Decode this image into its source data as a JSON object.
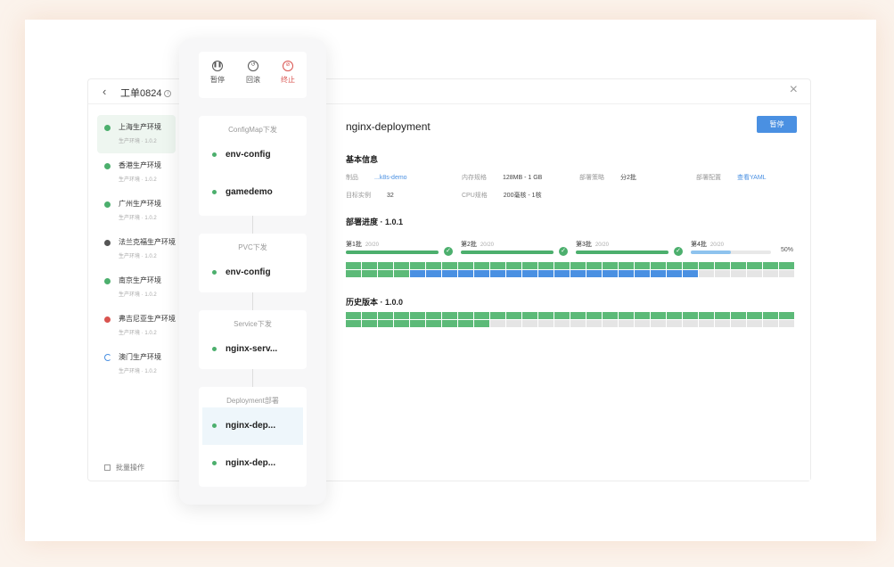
{
  "window": {
    "back_icon": "chevron-left-icon",
    "title": "工单0824",
    "info_icon": "i",
    "close_icon": "×"
  },
  "environments": [
    {
      "name": "上海生产环境",
      "sub": "生产环境 · 1.0.2",
      "status": "success",
      "color": "#4caf6d",
      "active": true
    },
    {
      "name": "香港生产环境",
      "sub": "生产环境 · 1.0.2",
      "status": "success",
      "color": "#4caf6d"
    },
    {
      "name": "广州生产环境",
      "sub": "生产环境 · 1.0.2",
      "status": "success",
      "color": "#4caf6d"
    },
    {
      "name": "法兰克福生产环境",
      "sub": "生产环境 · 1.0.2",
      "status": "paused",
      "color": "#555555"
    },
    {
      "name": "南京生产环境",
      "sub": "生产环境 · 1.0.2",
      "status": "success",
      "color": "#4caf6d"
    },
    {
      "name": "弗吉尼亚生产环境",
      "sub": "生产环境 · 1.0.2",
      "status": "error",
      "color": "#d9534f"
    },
    {
      "name": "澳门生产环境",
      "sub": "生产环境 · 1.0.2",
      "status": "loading",
      "color": "#4a90e2"
    }
  ],
  "batch_operation": "批量操作",
  "controls": {
    "pause": {
      "label": "暂停",
      "icon": "pause-icon"
    },
    "rollback": {
      "label": "回滚",
      "icon": "rollback-icon"
    },
    "stop": {
      "label": "终止",
      "icon": "stop-icon"
    }
  },
  "stages": [
    {
      "title": "ConfigMap下发",
      "items": [
        "env-config",
        "gamedemo"
      ]
    },
    {
      "title": "PVC下发",
      "items": [
        "env-config"
      ]
    },
    {
      "title": "Service下发",
      "items": [
        "nginx-serv..."
      ]
    },
    {
      "title": "Deployment部署",
      "items": [
        "nginx-dep...",
        "nginx-dep..."
      ]
    }
  ],
  "detail": {
    "title": "nginx-deployment",
    "pause_button": "暂停",
    "basic_info_title": "基本信息",
    "info": {
      "product_label": "制品",
      "product_value": "...k8s-demo",
      "memory_label": "内存规格",
      "memory_value": "128MB - 1 GB",
      "strategy_label": "部署策略",
      "strategy_value": "分2批",
      "config_label": "部署配置",
      "config_value": "查看YAML",
      "replicas_label": "目标实例",
      "replicas_value": "32",
      "cpu_label": "CPU规格",
      "cpu_value": "200毫核 - 1核"
    },
    "progress_title": "部署进度 · 1.0.1",
    "batches": [
      {
        "label": "第1批",
        "count": "20/20",
        "progress": 1.0,
        "done": true
      },
      {
        "label": "第2批",
        "count": "20/20",
        "progress": 1.0,
        "done": true
      },
      {
        "label": "第3批",
        "count": "20/20",
        "progress": 1.0,
        "done": true
      },
      {
        "label": "第4批",
        "count": "20/20",
        "progress": 0.5,
        "done": false,
        "percent_text": "50%"
      }
    ],
    "progress_grid": {
      "total": 56,
      "green": 32,
      "blue": 18,
      "gray": 6
    },
    "history_title": "历史版本 · 1.0.0",
    "history_grid": {
      "total": 56,
      "green": 37,
      "blue": 0,
      "gray": 19
    }
  },
  "colors": {
    "success": "#4caf6d",
    "running": "#4a90e2",
    "error": "#d9534f",
    "idle": "#e5e5e5"
  }
}
